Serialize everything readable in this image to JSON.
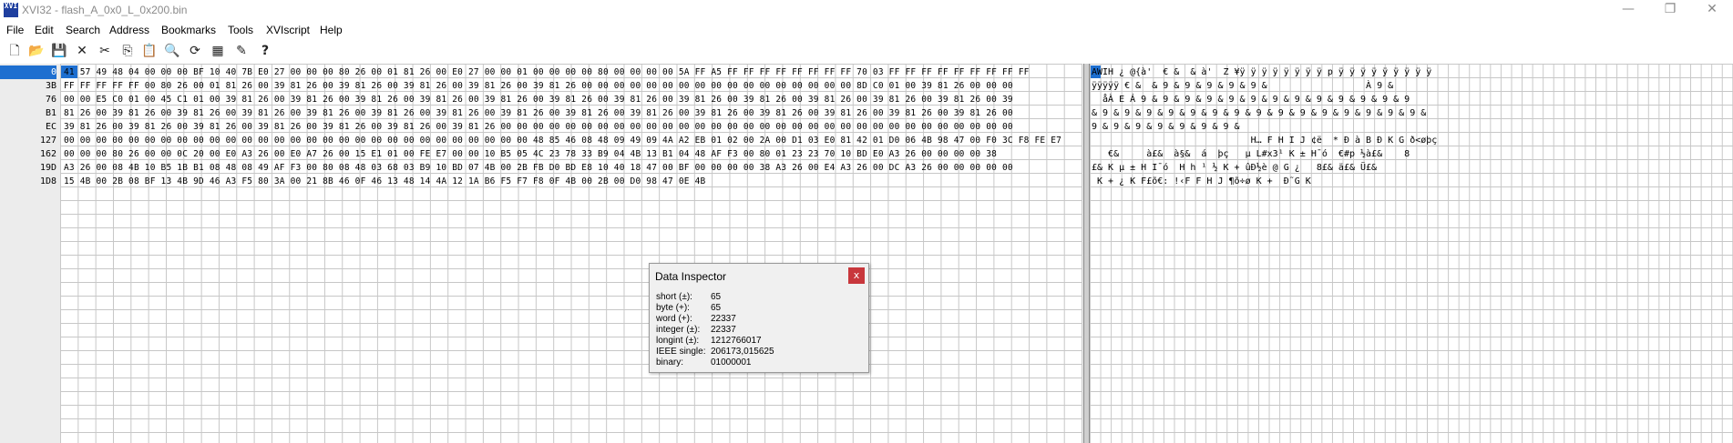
{
  "window": {
    "title": "XVI32 - flash_A_0x0_L_0x200.bin",
    "app_icon_text": "XVI",
    "minimize": "—",
    "maximize": "❐",
    "close": "✕"
  },
  "menu": [
    "File",
    "Edit",
    "Search",
    "Address",
    "Bookmarks",
    "Tools",
    "XVIscript",
    "Help"
  ],
  "toolbar": {
    "icons": [
      "new-file-icon",
      "open-folder-icon",
      "save-icon",
      "delete-icon",
      "cut-icon",
      "copy-icon",
      "paste-icon",
      "find-icon",
      "find-replace-icon",
      "bookmark-icon",
      "script-icon",
      "help-icon"
    ],
    "glyphs": [
      "🗋",
      "📂",
      "💾",
      "✕",
      "✂",
      "⎘",
      "📋",
      "🔍",
      "⟳",
      "▦",
      "✎",
      "?"
    ]
  },
  "addresses": [
    "0",
    "3B",
    "76",
    "B1",
    "EC",
    "127",
    "162",
    "19D",
    "1D8"
  ],
  "hex_rows": [
    "41 57 49 48 04 00 00 00 BF 10 40 7B E0 27 00 00 00 80 26 00 01 81 26 00 E0 27 00 00 01 00 00 00 00 80 00 00 00 00 5A FF A5 FF FF FF FF FF FF FF FF 70 03 FF FF FF FF FF FF FF FF FF",
    "FF FF FF FF FF 00 80 26 00 01 81 26 00 39 81 26 00 39 81 26 00 39 81 26 00 39 81 26 00 39 81 26 00 00 00 00 00 00 00 00 00 00 00 00 00 00 00 00 00 8D C0 01 00 39 81 26 00 00 00",
    "00 00 E5 C0 01 00 45 C1 01 00 39 81 26 00 39 81 26 00 39 81 26 00 39 81 26 00 39 81 26 00 39 81 26 00 39 81 26 00 39 81 26 00 39 81 26 00 39 81 26 00 39 81 26 00 39 81 26 00 39",
    "81 26 00 39 81 26 00 39 81 26 00 39 81 26 00 39 81 26 00 39 81 26 00 39 81 26 00 39 81 26 00 39 81 26 00 39 81 26 00 39 81 26 00 39 81 26 00 39 81 26 00 39 81 26 00 39 81 26 00",
    "39 81 26 00 39 81 26 00 39 81 26 00 39 81 26 00 39 81 26 00 39 81 26 00 39 81 26 00 00 00 00 00 00 00 00 00 00 00 00 00 00 00 00 00 00 00 00 00 00 00 00 00 00 00 00 00 00 00 00",
    "00 00 00 00 00 00 00 00 00 00 00 00 00 00 00 00 00 00 00 00 00 00 00 00 00 00 00 00 00 48 85 46 08 48 09 49 09 4A A2 EB 01 02 00 2A 00 D1 03 E0 81 42 01 D0 06 4B 98 47 00 F0 3C F8 FE E7",
    "00 00 00 80 26 00 00 0C 20 00 E0 A3 26 00 E0 A7 26 00 15 E1 01 00 FE E7 00 00 10 B5 05 4C 23 78 33 B9 04 4B 13 B1 04 48 AF F3 00 80 01 23 23 70 10 BD E0 A3 26 00 00 00 00 38",
    "A3 26 00 08 4B 10 B5 1B B1 08 48 08 49 AF F3 00 80 08 48 03 68 03 B9 10 BD 07 4B 00 2B FB D0 BD E8 10 40 18 47 00 BF 00 00 00 00 38 A3 26 00 E4 A3 26 00 DC A3 26 00 00 00 00 00",
    "15 4B 00 2B 08 BF 13 4B 9D 46 A3 F5 80 3A 00 21 8B 46 0F 46 13 48 14 4A 12 1A B6 F5 F7 F8 0F 4B 00 2B 00 D0 98 47 0E 4B"
  ],
  "char_rows": [
    "AWIH ¿ @{à'  € &  & à'  Z ¥ÿ ÿ ÿ ÿ ÿ ÿ ÿ ÿ p ÿ ÿ ÿ ÿ ÿ ÿ ÿ ÿ ÿ",
    "ÿÿÿÿÿ € &  & 9 & 9 & 9 & 9 & 9 &                  À 9 &",
    "  åÀ E Á 9 & 9 & 9 & 9 & 9 & 9 & 9 & 9 & 9 & 9 & 9 & 9 & 9",
    "& 9 & 9 & 9 & 9 & 9 & 9 & 9 & 9 & 9 & 9 & 9 & 9 & 9 & 9 & 9 &",
    "9 & 9 & 9 & 9 & 9 & 9 & 9 &",
    "                             H… F H I J ¢ë  * Ð à B Ð K G ð<øþç",
    "   €&     à£&  à§&  á  þç   µ L#x3¹ K ± H¯ó  €#p ½à£&    8",
    "£& K µ ± H I¯ó  H h ¹ ½ K + ûÐ½è @ G ¿   8£& ä£& Ü£&",
    " K + ¿ K F£õ€: !‹F F H J ¶õ÷ø K +  Ð˜G K"
  ],
  "inspector": {
    "title": "Data Inspector",
    "close": "x",
    "rows": [
      {
        "label": "short (±):",
        "value": "65"
      },
      {
        "label": "byte (+):",
        "value": "65"
      },
      {
        "label": "word (+):",
        "value": "22337"
      },
      {
        "label": "integer (±):",
        "value": "22337"
      },
      {
        "label": "longint (±):",
        "value": "1212766017"
      },
      {
        "label": "IEEE single:",
        "value": "206173,015625"
      },
      {
        "label": "binary:",
        "value": "01000001"
      }
    ]
  },
  "colors": {
    "selection": "#1e6fd0",
    "close_button": "#c8373c",
    "grid": "#c7c7c7"
  }
}
